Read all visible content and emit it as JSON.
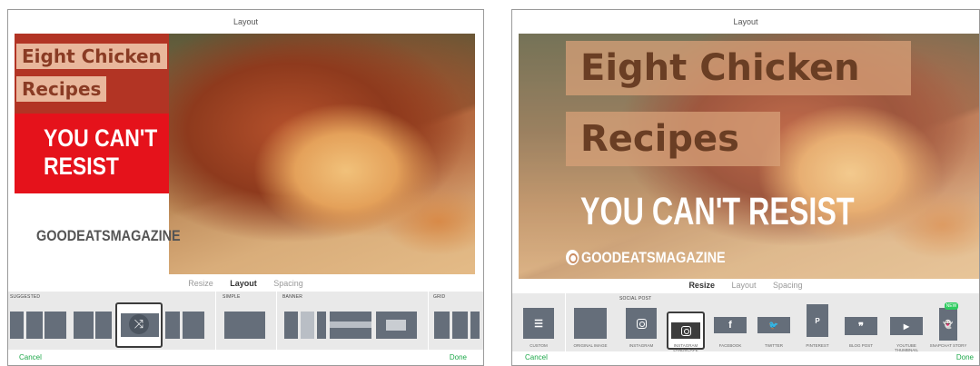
{
  "left": {
    "title": "Layout",
    "canvas": {
      "line1": "Eight Chicken",
      "line2": "Recipes",
      "tagline1": "YOU CAN'T",
      "tagline2": "RESIST",
      "brand": "GOODEATSMAGAZINE"
    },
    "tabs": {
      "resize": "Resize",
      "layout": "Layout",
      "spacing": "Spacing"
    },
    "sections": {
      "suggested": "SUGGESTED",
      "simple": "SIMPLE",
      "banner": "BANNER",
      "grid": "GRID"
    },
    "cancel": "Cancel",
    "done": "Done",
    "shuffle_glyph": "⤨"
  },
  "right": {
    "title": "Layout",
    "canvas": {
      "line1": "Eight Chicken",
      "line2": "Recipes",
      "tagline": "YOU CAN'T RESIST",
      "brand": "GOODEATSMAGAZINE"
    },
    "tabs": {
      "resize": "Resize",
      "layout": "Layout",
      "spacing": "Spacing"
    },
    "social_post_label": "SOCIAL POST",
    "new_badge": "NEW",
    "tiles": [
      {
        "label": "CUSTOM",
        "icon": "sliders-icon",
        "glyph": "☰"
      },
      {
        "label": "ORIGINAL IMAGE",
        "icon": "original-image-icon",
        "glyph": ""
      },
      {
        "label": "INSTAGRAM",
        "icon": "instagram-icon",
        "glyph": ""
      },
      {
        "label": "INSTAGRAM LANDSCAPE",
        "icon": "instagram-icon",
        "glyph": ""
      },
      {
        "label": "FACEBOOK",
        "icon": "facebook-icon",
        "glyph": "f"
      },
      {
        "label": "TWITTER",
        "icon": "twitter-icon",
        "glyph": "🐦"
      },
      {
        "label": "PINTEREST",
        "icon": "pinterest-icon",
        "glyph": "P"
      },
      {
        "label": "BLOG POST",
        "icon": "quote-icon",
        "glyph": "❞"
      },
      {
        "label": "YOUTUBE THUMBNAIL",
        "icon": "youtube-icon",
        "glyph": "▶"
      },
      {
        "label": "SNAPCHAT STORY",
        "icon": "snapchat-icon",
        "glyph": "👻"
      }
    ],
    "cancel": "Cancel",
    "done": "Done"
  },
  "colors": {
    "accent_green": "#1ea84a",
    "thumb_gray": "#656e7a",
    "red": "#e5121b",
    "dark_red": "#b23424"
  }
}
